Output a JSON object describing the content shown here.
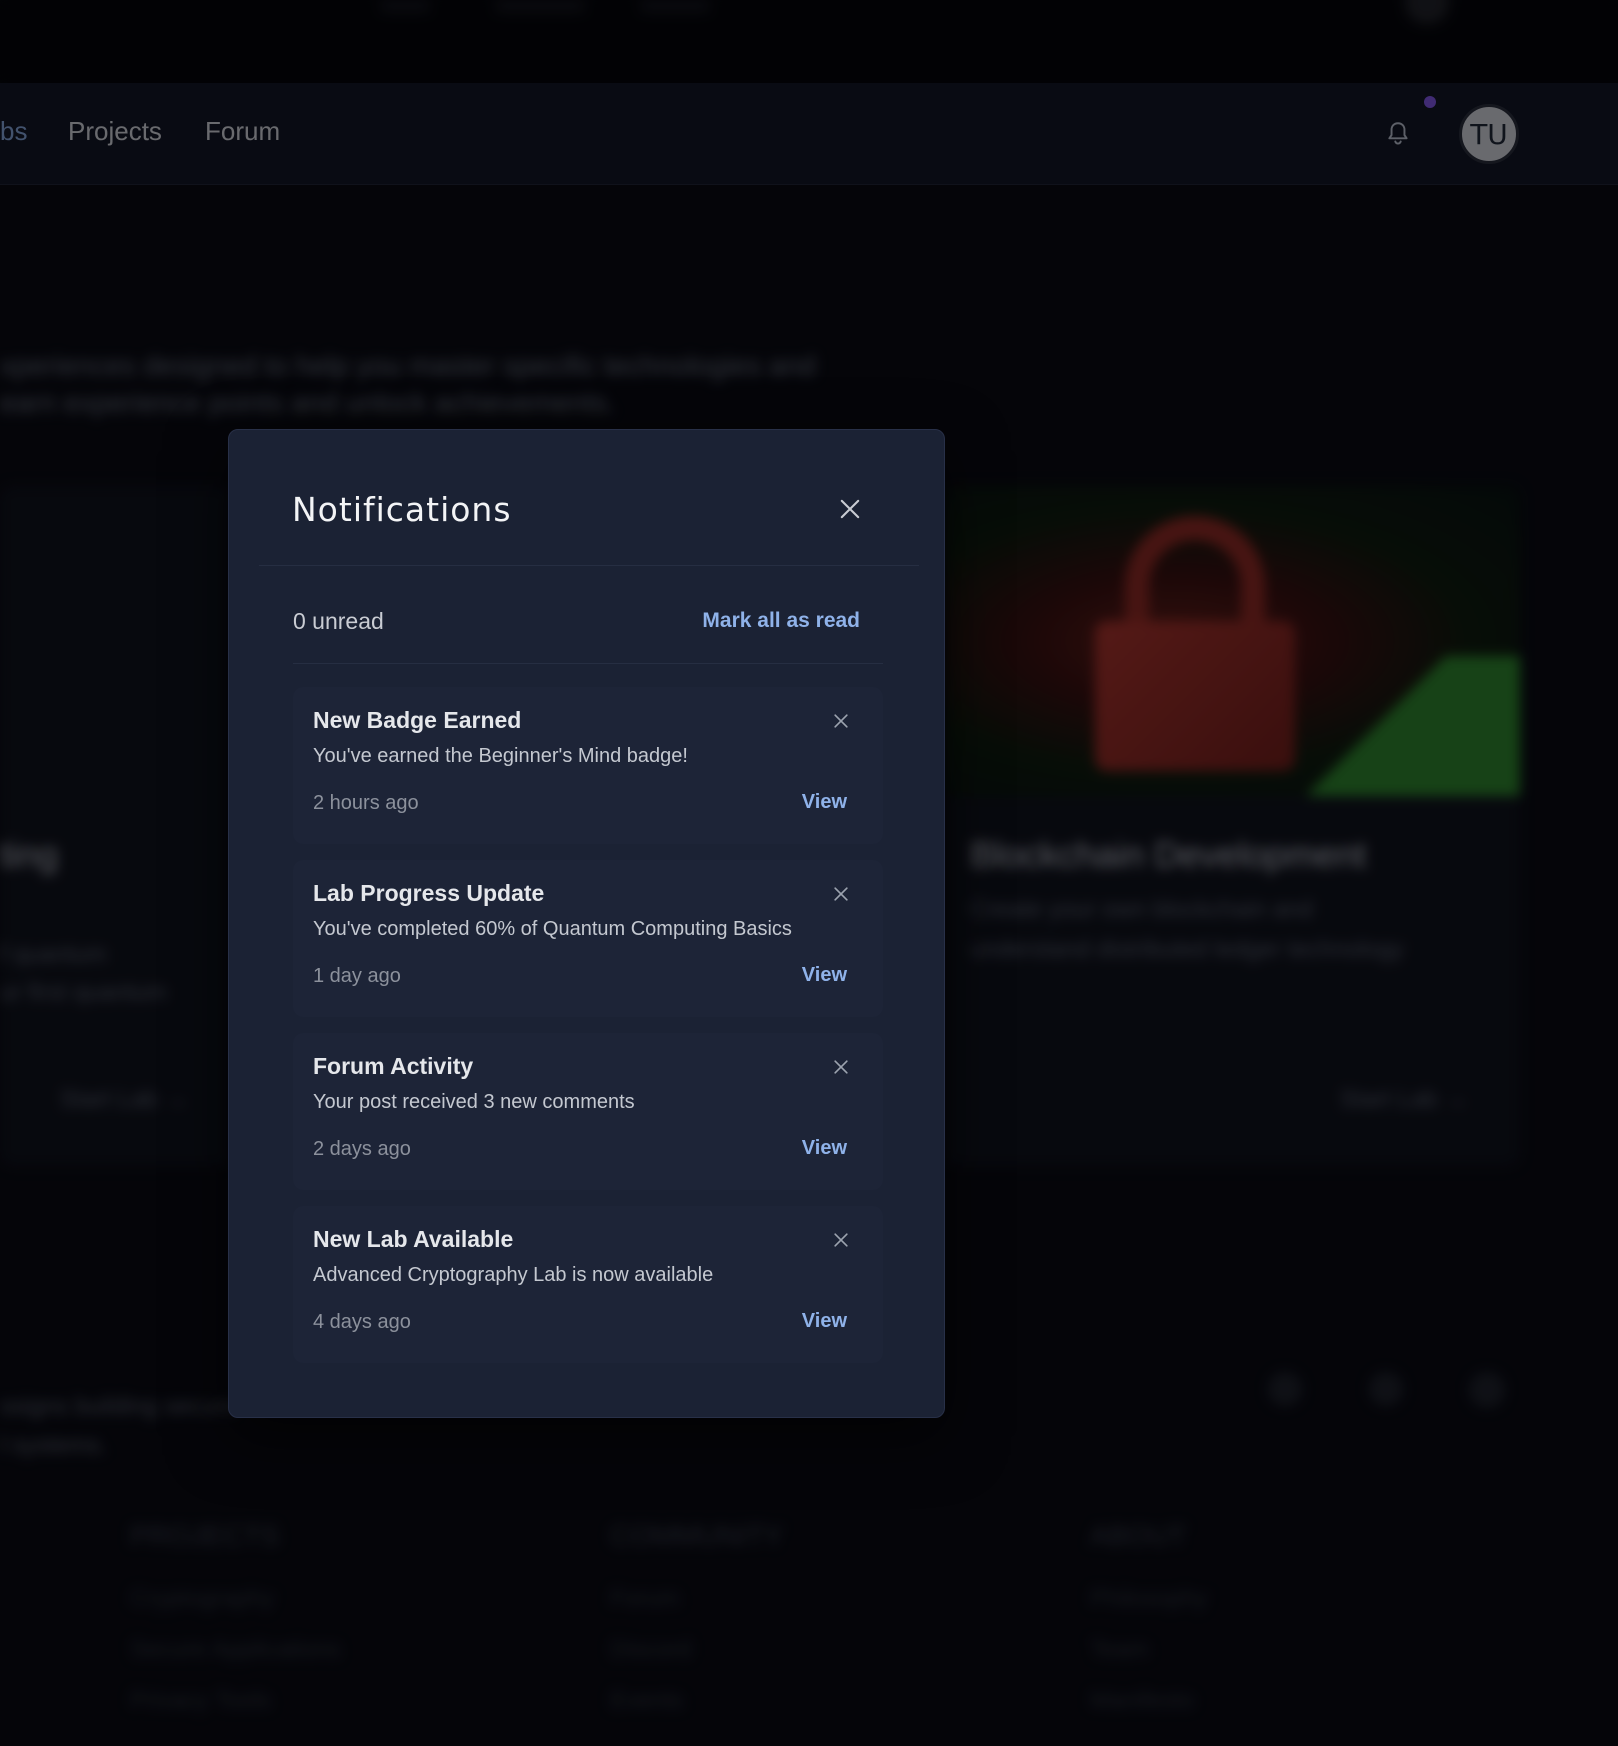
{
  "nav": {
    "links": [
      {
        "label": "bs",
        "active": true
      },
      {
        "label": "Projects",
        "active": false
      },
      {
        "label": "Forum",
        "active": false
      }
    ],
    "notification_icon": "bell-icon",
    "has_unread_indicator": true,
    "indicator_color": "#8b5cf6",
    "avatar_initials": "TU",
    "accent_color": "#8fb2e9"
  },
  "modal": {
    "title": "Notifications",
    "close_icon": "close-icon",
    "unread_label": "0 unread",
    "mark_all_label": "Mark all as read",
    "items": [
      {
        "title": "New Badge Earned",
        "message": "You've earned the Beginner's Mind badge!",
        "time": "2 hours ago",
        "action": "View"
      },
      {
        "title": "Lab Progress Update",
        "message": "You've completed 60% of Quantum Computing Basics",
        "time": "1 day ago",
        "action": "View"
      },
      {
        "title": "Forum Activity",
        "message": "Your post received 3 new comments",
        "time": "2 days ago",
        "action": "View"
      },
      {
        "title": "New Lab Available",
        "message": "Advanced Cryptography Lab is now available",
        "time": "4 days ago",
        "action": "View"
      }
    ]
  }
}
